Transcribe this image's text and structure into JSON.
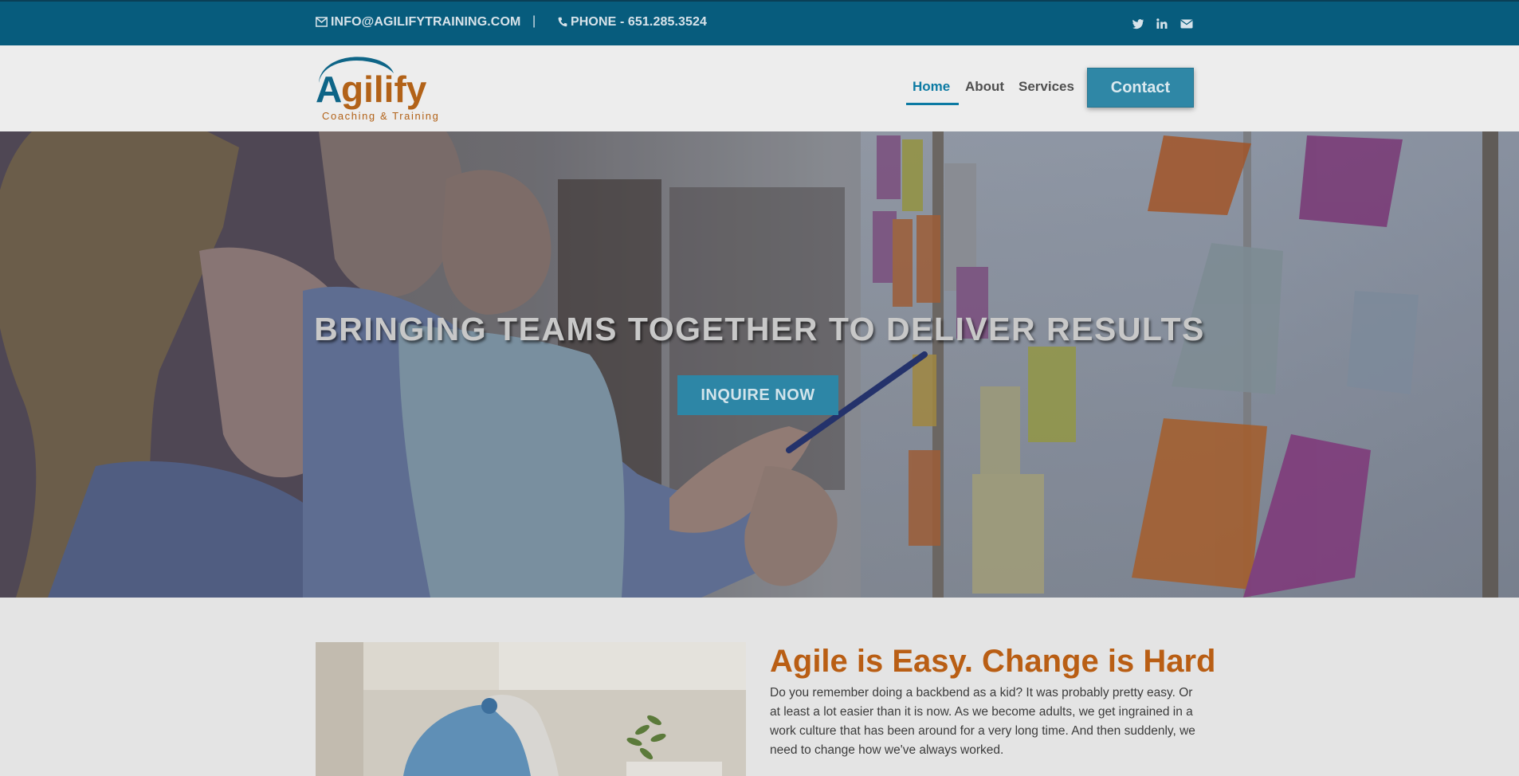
{
  "topbar": {
    "email": "INFO@AGILIFYTRAINING.COM",
    "separator": "|",
    "phone": "PHONE - 651.285.3524",
    "social_icons": [
      "twitter-icon",
      "linkedin-icon",
      "envelope-icon"
    ]
  },
  "header": {
    "logo_text": "Agilify",
    "logo_tagline": "Coaching & Training",
    "nav": {
      "home": "Home",
      "about": "About",
      "services": "Services",
      "contact": "Contact"
    }
  },
  "hero": {
    "title": "BRINGING TEAMS TOGETHER TO DELIVER RESULTS",
    "cta": "INQUIRE NOW"
  },
  "intro": {
    "title": "Agile is Easy. Change is Hard",
    "body": "Do you remember doing a backbend as a kid? It was probably pretty easy. Or at least a lot easier than it is now. As we become adults, we get ingrained in a work culture that has been around for a very long time. And then suddenly, we need to change how we've always worked."
  },
  "colors": {
    "topbar": "#075c7d",
    "accent": "#0c7aa3",
    "button": "#2f87a6",
    "heading": "#b95e14"
  }
}
